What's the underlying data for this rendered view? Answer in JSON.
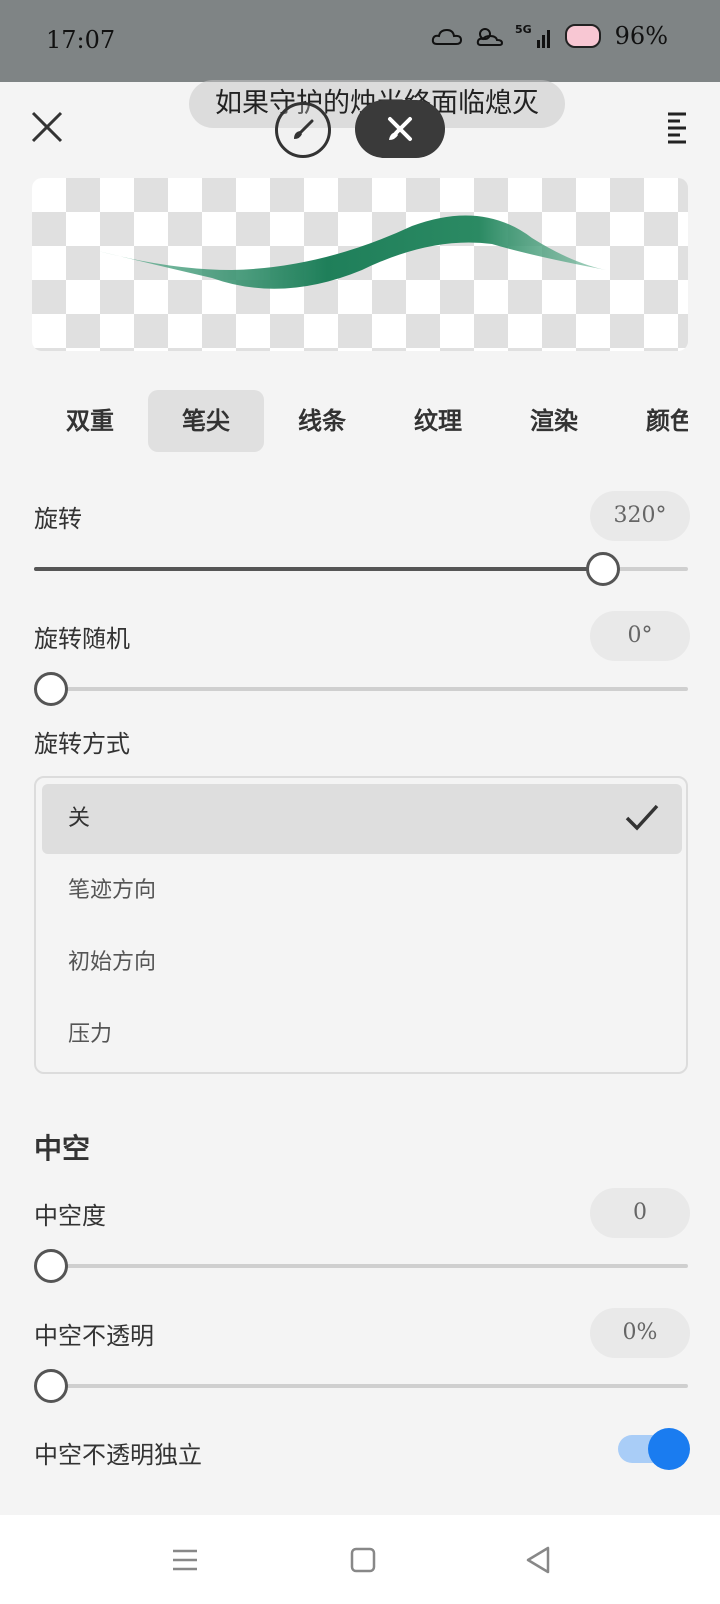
{
  "status_bar": {
    "time": "17:07",
    "network": "5G",
    "battery": "96%",
    "icons": [
      "cloud-weather-icon",
      "sun-weather-icon",
      "5g-signal-icon",
      "cat-battery-icon"
    ]
  },
  "toolbar": {
    "song_banner": "如果守护的烛光终面临熄灭",
    "close_icon": "close-icon",
    "brush_icon": "brush-icon",
    "eraser_icon": "eraser-icon",
    "menu_icon": "menu-icon"
  },
  "stroke_preview": {
    "stroke_color": "#1f7f5a"
  },
  "tabs": [
    {
      "label": "双重",
      "active": false
    },
    {
      "label": "笔尖",
      "active": true
    },
    {
      "label": "线条",
      "active": false
    },
    {
      "label": "纹理",
      "active": false
    },
    {
      "label": "渲染",
      "active": false
    },
    {
      "label": "颜色",
      "active": false
    }
  ],
  "settings": {
    "rotation": {
      "label": "旋转",
      "value": "320°",
      "fraction": 0.87
    },
    "rotation_random": {
      "label": "旋转随机",
      "value": "0°",
      "fraction": 0.0
    },
    "rotation_mode": {
      "label": "旋转方式",
      "options": [
        "关",
        "笔迹方向",
        "初始方向",
        "压力"
      ],
      "selected": "关"
    },
    "hollow": {
      "section_title": "中空",
      "degree": {
        "label": "中空度",
        "value": "0",
        "fraction": 0.0
      },
      "opacity": {
        "label": "中空不透明",
        "value": "0%",
        "fraction": 0.0
      },
      "opacity_independent": {
        "label": "中空不透明独立",
        "enabled": true
      }
    }
  },
  "colors": {
    "accent": "#1a7cf0",
    "accent_light": "#a9cdf7"
  },
  "nav_bar": {
    "icons": [
      "menu-nav-icon",
      "home-nav-icon",
      "back-nav-icon"
    ]
  }
}
